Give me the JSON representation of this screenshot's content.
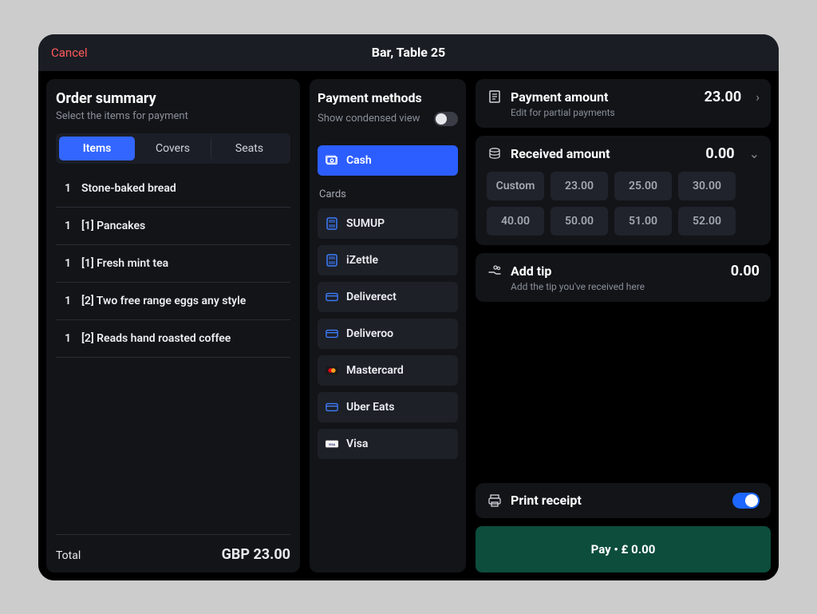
{
  "topbar": {
    "cancel": "Cancel",
    "title": "Bar, Table 25"
  },
  "order": {
    "heading": "Order summary",
    "sub": "Select the items for payment",
    "tabs": [
      "Items",
      "Covers",
      "Seats"
    ],
    "activeTab": 0,
    "items": [
      {
        "qty": "1",
        "label": "Stone-baked bread"
      },
      {
        "qty": "1",
        "label": "[1] Pancakes"
      },
      {
        "qty": "1",
        "label": "[1] Fresh mint tea"
      },
      {
        "qty": "1",
        "label": "[2] Two free range eggs any style"
      },
      {
        "qty": "1",
        "label": "[2] Reads hand roasted coffee"
      }
    ],
    "total_label": "Total",
    "total_value": "GBP  23.00"
  },
  "methods": {
    "heading": "Payment methods",
    "condensed_label": "Show condensed view",
    "condensed_on": false,
    "selected": "Cash",
    "cards_label": "Cards",
    "items": [
      "SUMUP",
      "iZettle",
      "Deliverect",
      "Deliveroo",
      "Mastercard",
      "Uber Eats",
      "Visa"
    ]
  },
  "payment_amount": {
    "title": "Payment amount",
    "value": "23.00",
    "hint": "Edit for partial payments"
  },
  "received": {
    "title": "Received amount",
    "value": "0.00",
    "custom_label": "Custom",
    "amounts": [
      "23.00",
      "25.00",
      "30.00",
      "40.00",
      "50.00",
      "51.00",
      "52.00"
    ]
  },
  "tip": {
    "title": "Add tip",
    "value": "0.00",
    "hint": "Add the tip you've received here"
  },
  "print": {
    "label": "Print receipt",
    "on": true
  },
  "pay": {
    "label": "Pay  •  £ 0.00"
  }
}
